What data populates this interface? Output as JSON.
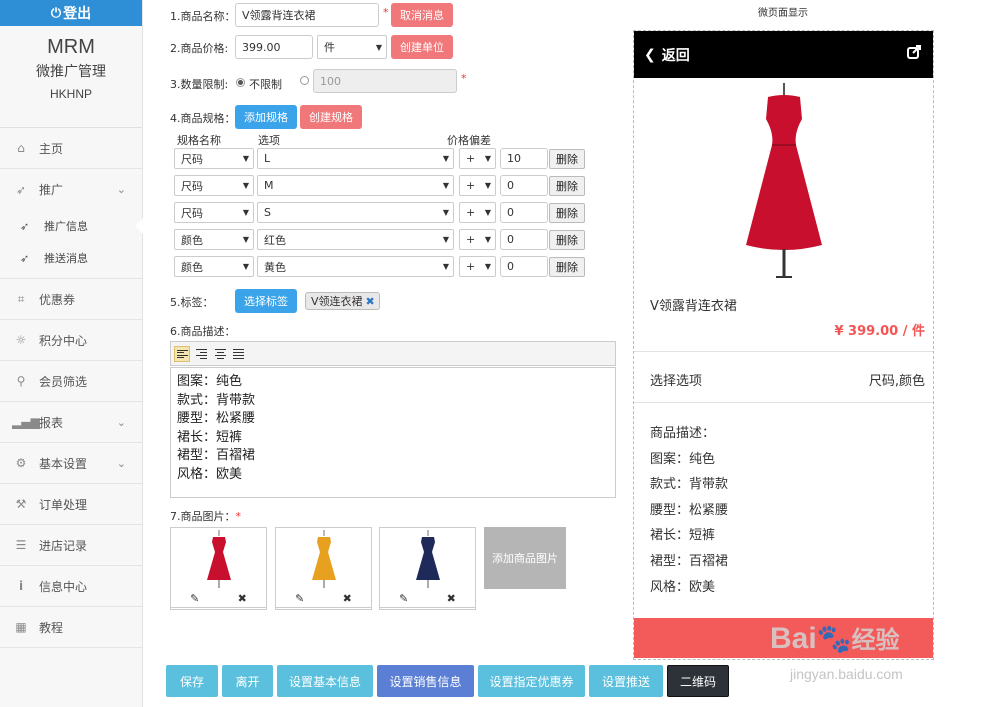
{
  "sidebar": {
    "logout": "登出",
    "brand_title": "MRM",
    "brand_sub": "微推广管理",
    "brand_code": "HKHNP",
    "home": "主页",
    "promo": "推广",
    "promo_info": "推广信息",
    "push_msg": "推送消息",
    "coupon": "优惠券",
    "points": "积分中心",
    "member_filter": "会员筛选",
    "report": "报表",
    "basic_settings": "基本设置",
    "orders": "订单处理",
    "visits": "进店记录",
    "info_center": "信息中心",
    "tutorial": "教程"
  },
  "form": {
    "name_label": "1.商品名称：",
    "name_value": "V领露背连衣裙",
    "cancel_promo": "取消消息",
    "price_label": "2.商品价格:",
    "price_value": "399.00",
    "unit_value": "件",
    "create_unit": "创建单位",
    "qty_label": "3.数量限制:",
    "unlimited": "不限制",
    "qty_placeholder": "100",
    "spec_label": "4.商品规格：",
    "add_spec": "添加规格",
    "create_spec": "创建规格",
    "col_spec_name": "规格名称",
    "col_option": "选项",
    "col_price_diff": "价格偏差",
    "delete_label": "删除",
    "spec_rows": [
      {
        "name": "尺码",
        "option": "L",
        "sign": "+",
        "diff": "10"
      },
      {
        "name": "尺码",
        "option": "M",
        "sign": "+",
        "diff": "0"
      },
      {
        "name": "尺码",
        "option": "S",
        "sign": "+",
        "diff": "0"
      },
      {
        "name": "颜色",
        "option": "红色",
        "sign": "+",
        "diff": "0"
      },
      {
        "name": "颜色",
        "option": "黄色",
        "sign": "+",
        "diff": "0"
      }
    ],
    "tag_label": "5.标签：",
    "choose_tag": "选择标签",
    "tag_value": "V领连衣裙",
    "desc_label": "6.商品描述：",
    "desc_lines": [
      "图案：纯色",
      "款式：背带款",
      "腰型：松紧腰",
      "裙长：短裤",
      "裙型：百褶裙",
      "风格：欧美"
    ],
    "img_label": "7.商品图片：",
    "add_image": "添加商品图片",
    "thumb_colors": [
      "#c8102e",
      "#e8a020",
      "#1e2a5a"
    ]
  },
  "bottom": {
    "save": "保存",
    "leave": "离开",
    "basic_info": "设置基本信息",
    "sales_info": "设置销售信息",
    "coupon": "设置指定优惠券",
    "push": "设置推送",
    "qrcode": "二维码"
  },
  "preview": {
    "title": "微页面显示",
    "back": "返回",
    "product_name": "V领露背连衣裙",
    "price": "¥ 399.00 / 件",
    "choose_label": "选择选项",
    "choose_value": "尺码,颜色",
    "desc_title": "商品描述：",
    "desc_lines": [
      "图案：纯色",
      "款式：背带款",
      "腰型：松紧腰",
      "裙长：短裤",
      "裙型：百褶裙",
      "风格：欧美"
    ]
  },
  "watermark": {
    "brand_latin": "Bai",
    "brand_cn": "经验",
    "url": "jingyan.baidu.com"
  },
  "colors": {
    "primary_blue": "#3aa3ea",
    "danger_red": "#f0777a",
    "button_cyan": "#5bc0de",
    "button_indigo": "#5b7fd4",
    "button_dark": "#2c3238",
    "price_red": "#f35454"
  }
}
